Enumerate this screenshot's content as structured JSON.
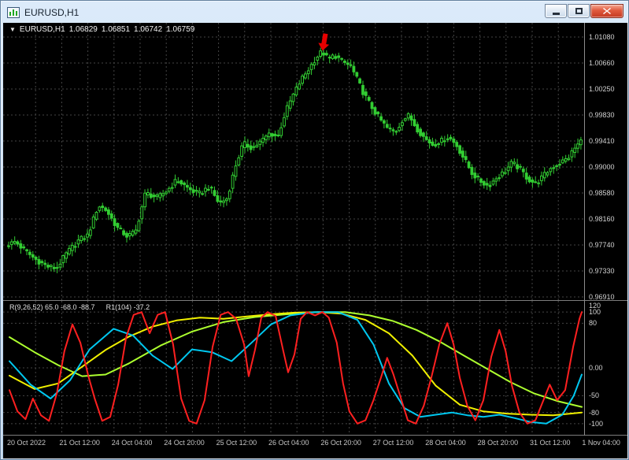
{
  "window": {
    "title": "EURUSD,H1"
  },
  "chart": {
    "info": {
      "collapse_icon": "▼",
      "symbol": "EURUSD,H1",
      "open": "1.06829",
      "high": "1.06851",
      "low": "1.06742",
      "close": "1.06759"
    },
    "indicator_info": {
      "left": "R(9,26,52) 65.0 -68.0 -88.7",
      "right": "R1(104) -37.2"
    }
  },
  "chart_data": {
    "type": "candlestick",
    "symbol": "EURUSD",
    "timeframe": "H1",
    "bars": 190,
    "colors": {
      "up": "#32cd32",
      "grid": "#454545",
      "bg": "#000000",
      "arrow": "#e60000"
    },
    "price_axis": {
      "max": 1.0108,
      "min": 0.9691,
      "ticks": [
        "1.01080",
        "1.00660",
        "1.00250",
        "0.99830",
        "0.99410",
        "0.99000",
        "0.98580",
        "0.98160",
        "0.97740",
        "0.97330",
        "0.96910"
      ]
    },
    "time_axis": {
      "labels": [
        "20 Oct 2022",
        "21 Oct 12:00",
        "24 Oct 04:00",
        "24 Oct 20:00",
        "25 Oct 12:00",
        "26 Oct 04:00",
        "26 Oct 20:00",
        "27 Oct 12:00",
        "28 Oct 04:00",
        "28 Oct 20:00",
        "31 Oct 12:00",
        "1 Nov 04:00"
      ]
    },
    "price_path": [
      [
        0.0,
        0.9773
      ],
      [
        0.017,
        0.978
      ],
      [
        0.03,
        0.9768
      ],
      [
        0.051,
        0.9752
      ],
      [
        0.072,
        0.974
      ],
      [
        0.088,
        0.9737
      ],
      [
        0.106,
        0.9761
      ],
      [
        0.127,
        0.9782
      ],
      [
        0.143,
        0.979
      ],
      [
        0.161,
        0.9838
      ],
      [
        0.175,
        0.983
      ],
      [
        0.195,
        0.9801
      ],
      [
        0.212,
        0.9788
      ],
      [
        0.226,
        0.9796
      ],
      [
        0.243,
        0.9858
      ],
      [
        0.264,
        0.985
      ],
      [
        0.281,
        0.9862
      ],
      [
        0.298,
        0.9879
      ],
      [
        0.319,
        0.9864
      ],
      [
        0.336,
        0.9856
      ],
      [
        0.354,
        0.9868
      ],
      [
        0.371,
        0.9841
      ],
      [
        0.385,
        0.9849
      ],
      [
        0.399,
        0.99
      ],
      [
        0.413,
        0.9937
      ],
      [
        0.429,
        0.993
      ],
      [
        0.446,
        0.9942
      ],
      [
        0.459,
        0.9954
      ],
      [
        0.473,
        0.9948
      ],
      [
        0.487,
        0.9989
      ],
      [
        0.501,
        1.0017
      ],
      [
        0.514,
        1.004
      ],
      [
        0.528,
        1.0058
      ],
      [
        0.539,
        1.0074
      ],
      [
        0.55,
        1.0085
      ],
      [
        0.561,
        1.0072
      ],
      [
        0.572,
        1.0079
      ],
      [
        0.586,
        1.0068
      ],
      [
        0.6,
        1.0061
      ],
      [
        0.611,
        1.004
      ],
      [
        0.622,
        1.0018
      ],
      [
        0.636,
        0.9996
      ],
      [
        0.649,
        0.9978
      ],
      [
        0.663,
        0.9962
      ],
      [
        0.677,
        0.9955
      ],
      [
        0.69,
        0.9975
      ],
      [
        0.701,
        0.9982
      ],
      [
        0.715,
        0.9961
      ],
      [
        0.729,
        0.9945
      ],
      [
        0.743,
        0.9935
      ],
      [
        0.757,
        0.9941
      ],
      [
        0.77,
        0.9948
      ],
      [
        0.784,
        0.9934
      ],
      [
        0.798,
        0.9911
      ],
      [
        0.811,
        0.9889
      ],
      [
        0.825,
        0.9877
      ],
      [
        0.839,
        0.9869
      ],
      [
        0.853,
        0.9882
      ],
      [
        0.866,
        0.9891
      ],
      [
        0.88,
        0.9906
      ],
      [
        0.894,
        0.9897
      ],
      [
        0.908,
        0.988
      ],
      [
        0.921,
        0.9873
      ],
      [
        0.935,
        0.9885
      ],
      [
        0.949,
        0.9899
      ],
      [
        0.963,
        0.9906
      ],
      [
        0.977,
        0.9913
      ],
      [
        0.988,
        0.9928
      ],
      [
        1.0,
        0.9941
      ]
    ],
    "annotation": {
      "type": "arrow-down",
      "t": 0.547,
      "price": 1.0086
    },
    "indicator": {
      "range": [
        -120,
        120
      ],
      "axis_ticks": [
        {
          "v": 120,
          "label": "120"
        },
        {
          "v": 100,
          "label": "100"
        },
        {
          "v": 80,
          "label": "80"
        },
        {
          "v": 0,
          "label": "0.00"
        },
        {
          "v": -50,
          "label": "-50"
        },
        {
          "v": -80,
          "label": "-80"
        },
        {
          "v": -100,
          "label": "-100"
        }
      ],
      "grid_levels": [
        100,
        80,
        0,
        -50,
        -80,
        -100
      ],
      "series": [
        {
          "name": "R1-slow",
          "color": "#adff2f",
          "width": 2,
          "points": [
            [
              0.0,
              55
            ],
            [
              0.044,
              28
            ],
            [
              0.085,
              5
            ],
            [
              0.127,
              -15
            ],
            [
              0.168,
              -12
            ],
            [
              0.209,
              8
            ],
            [
              0.264,
              40
            ],
            [
              0.319,
              65
            ],
            [
              0.374,
              82
            ],
            [
              0.429,
              91
            ],
            [
              0.484,
              96
            ],
            [
              0.539,
              100
            ],
            [
              0.587,
              100
            ],
            [
              0.629,
              94
            ],
            [
              0.67,
              84
            ],
            [
              0.711,
              68
            ],
            [
              0.752,
              47
            ],
            [
              0.794,
              22
            ],
            [
              0.835,
              -2
            ],
            [
              0.876,
              -26
            ],
            [
              0.917,
              -46
            ],
            [
              0.959,
              -60
            ],
            [
              1.0,
              -70
            ]
          ]
        },
        {
          "name": "R-slow",
          "color": "#f0f000",
          "width": 2,
          "points": [
            [
              0.0,
              -14
            ],
            [
              0.044,
              -38
            ],
            [
              0.085,
              -28
            ],
            [
              0.127,
              2
            ],
            [
              0.168,
              32
            ],
            [
              0.209,
              56
            ],
            [
              0.25,
              74
            ],
            [
              0.292,
              85
            ],
            [
              0.333,
              90
            ],
            [
              0.374,
              88
            ],
            [
              0.415,
              92
            ],
            [
              0.457,
              96
            ],
            [
              0.498,
              99
            ],
            [
              0.539,
              100
            ],
            [
              0.581,
              97
            ],
            [
              0.622,
              86
            ],
            [
              0.663,
              62
            ],
            [
              0.704,
              22
            ],
            [
              0.745,
              -32
            ],
            [
              0.787,
              -66
            ],
            [
              0.828,
              -78
            ],
            [
              0.869,
              -82
            ],
            [
              0.91,
              -84
            ],
            [
              0.95,
              -85
            ],
            [
              1.0,
              -80
            ]
          ]
        },
        {
          "name": "R-mid",
          "color": "#00c8f0",
          "width": 2,
          "points": [
            [
              0.0,
              12
            ],
            [
              0.037,
              -30
            ],
            [
              0.072,
              -55
            ],
            [
              0.106,
              -22
            ],
            [
              0.14,
              33
            ],
            [
              0.182,
              70
            ],
            [
              0.216,
              58
            ],
            [
              0.25,
              22
            ],
            [
              0.285,
              -2
            ],
            [
              0.319,
              33
            ],
            [
              0.354,
              28
            ],
            [
              0.388,
              12
            ],
            [
              0.422,
              44
            ],
            [
              0.457,
              78
            ],
            [
              0.491,
              94
            ],
            [
              0.532,
              100
            ],
            [
              0.574,
              100
            ],
            [
              0.608,
              86
            ],
            [
              0.636,
              42
            ],
            [
              0.663,
              -28
            ],
            [
              0.69,
              -72
            ],
            [
              0.718,
              -88
            ],
            [
              0.745,
              -84
            ],
            [
              0.773,
              -80
            ],
            [
              0.8,
              -85
            ],
            [
              0.828,
              -88
            ],
            [
              0.856,
              -84
            ],
            [
              0.883,
              -90
            ],
            [
              0.91,
              -97
            ],
            [
              0.938,
              -100
            ],
            [
              0.966,
              -84
            ],
            [
              0.986,
              -50
            ],
            [
              1.0,
              -12
            ]
          ]
        },
        {
          "name": "R-fast",
          "color": "#ff2020",
          "width": 2,
          "points": [
            [
              0.0,
              -40
            ],
            [
              0.014,
              -78
            ],
            [
              0.028,
              -92
            ],
            [
              0.041,
              -55
            ],
            [
              0.055,
              -85
            ],
            [
              0.069,
              -95
            ],
            [
              0.083,
              -45
            ],
            [
              0.096,
              30
            ],
            [
              0.11,
              78
            ],
            [
              0.124,
              45
            ],
            [
              0.138,
              -15
            ],
            [
              0.149,
              -55
            ],
            [
              0.162,
              -95
            ],
            [
              0.176,
              -88
            ],
            [
              0.19,
              -30
            ],
            [
              0.204,
              55
            ],
            [
              0.217,
              95
            ],
            [
              0.231,
              100
            ],
            [
              0.245,
              62
            ],
            [
              0.259,
              95
            ],
            [
              0.272,
              100
            ],
            [
              0.286,
              42
            ],
            [
              0.3,
              -55
            ],
            [
              0.314,
              -95
            ],
            [
              0.327,
              -100
            ],
            [
              0.341,
              -58
            ],
            [
              0.355,
              38
            ],
            [
              0.369,
              95
            ],
            [
              0.382,
              100
            ],
            [
              0.396,
              88
            ],
            [
              0.41,
              42
            ],
            [
              0.418,
              -15
            ],
            [
              0.429,
              32
            ],
            [
              0.44,
              90
            ],
            [
              0.451,
              100
            ],
            [
              0.465,
              93
            ],
            [
              0.479,
              28
            ],
            [
              0.487,
              -8
            ],
            [
              0.498,
              24
            ],
            [
              0.509,
              88
            ],
            [
              0.52,
              100
            ],
            [
              0.534,
              94
            ],
            [
              0.547,
              100
            ],
            [
              0.558,
              90
            ],
            [
              0.572,
              45
            ],
            [
              0.583,
              -28
            ],
            [
              0.594,
              -78
            ],
            [
              0.608,
              -100
            ],
            [
              0.622,
              -94
            ],
            [
              0.636,
              -58
            ],
            [
              0.649,
              -18
            ],
            [
              0.66,
              18
            ],
            [
              0.671,
              -12
            ],
            [
              0.685,
              -58
            ],
            [
              0.696,
              -94
            ],
            [
              0.71,
              -100
            ],
            [
              0.724,
              -68
            ],
            [
              0.737,
              -18
            ],
            [
              0.751,
              42
            ],
            [
              0.765,
              80
            ],
            [
              0.776,
              42
            ],
            [
              0.787,
              -18
            ],
            [
              0.8,
              -68
            ],
            [
              0.814,
              -94
            ],
            [
              0.828,
              -58
            ],
            [
              0.842,
              20
            ],
            [
              0.856,
              68
            ],
            [
              0.867,
              30
            ],
            [
              0.878,
              -32
            ],
            [
              0.891,
              -80
            ],
            [
              0.905,
              -100
            ],
            [
              0.919,
              -94
            ],
            [
              0.933,
              -58
            ],
            [
              0.944,
              -30
            ],
            [
              0.957,
              -58
            ],
            [
              0.971,
              -40
            ],
            [
              0.985,
              38
            ],
            [
              0.996,
              88
            ],
            [
              1.0,
              100
            ]
          ]
        }
      ]
    }
  }
}
